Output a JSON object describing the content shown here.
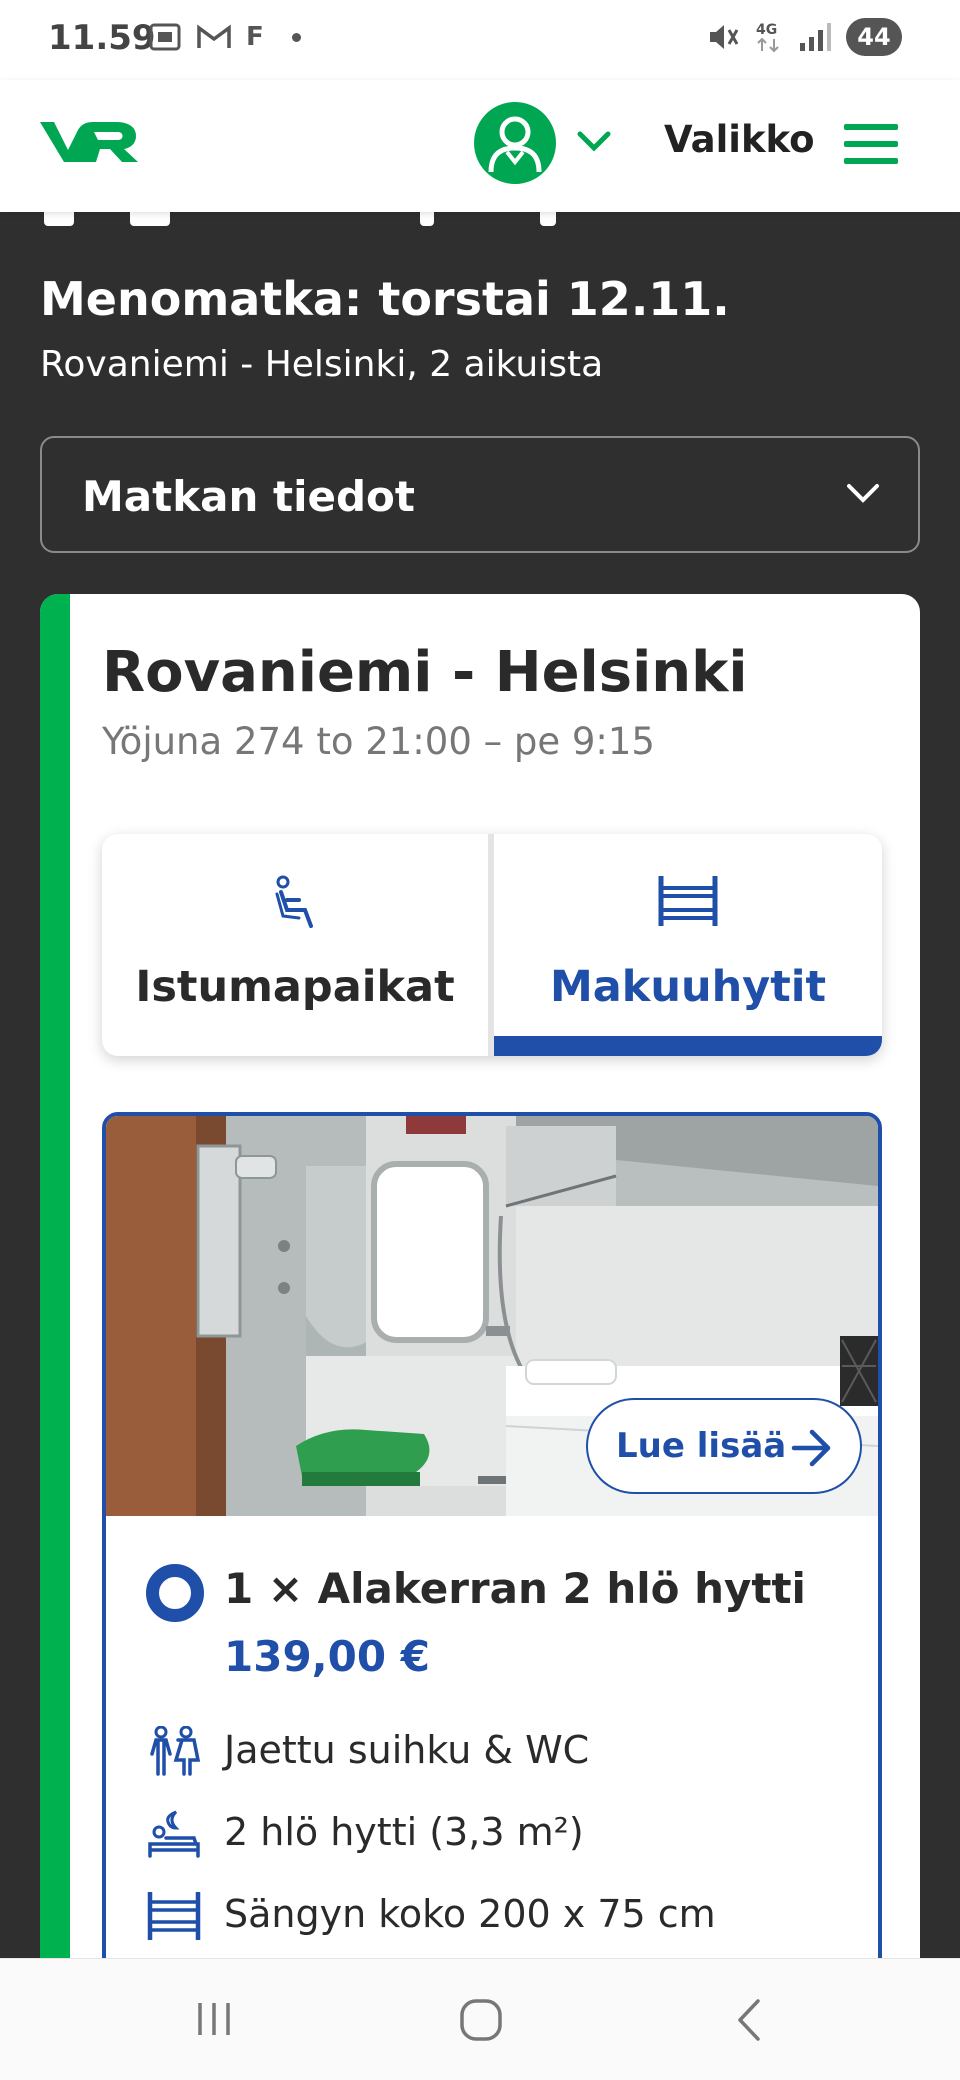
{
  "status_bar": {
    "time": "11.59",
    "icons": [
      "screenshot-icon",
      "gmail-icon",
      "f-app-icon",
      "notification-dot-icon"
    ],
    "f_label": "F",
    "right_icons": [
      "mute-icon",
      "4g-icon",
      "signal-icon"
    ],
    "battery": "44"
  },
  "header": {
    "logo_text": "VR",
    "menu_label": "Valikko",
    "brand_color": "#00a651"
  },
  "trip": {
    "title": "Menomatka: torstai 12.11.",
    "subtitle": "Rovaniemi - Helsinki, 2 aikuista",
    "details_label": "Matkan tiedot"
  },
  "card": {
    "route": "Rovaniemi - Helsinki",
    "train": "Yöjuna 274 to 21:00 – pe 9:15",
    "tabs": [
      {
        "label": "Istumapaikat",
        "icon": "seat-icon",
        "selected": false
      },
      {
        "label": "Makuuhytit",
        "icon": "bunk-bed-icon",
        "selected": true
      }
    ],
    "cabin": {
      "read_more": "Lue lisää",
      "title": "1 × Alakerran 2 hlö hytti",
      "price": "139,00 €",
      "features": [
        {
          "icon": "shared-shower-icon",
          "text": "Jaettu suihku & WC"
        },
        {
          "icon": "sleeping-person-icon",
          "text": "2 hlö hytti (3,3 m²)"
        },
        {
          "icon": "bed-size-icon",
          "text": "Sängyn koko 200 x 75 cm"
        }
      ]
    }
  },
  "colors": {
    "accent_blue": "#1f4fa8",
    "green_stripe": "#00b14f",
    "background": "#2f2f2f"
  },
  "nav_bar": [
    "recent-apps-icon",
    "home-icon",
    "back-icon"
  ]
}
